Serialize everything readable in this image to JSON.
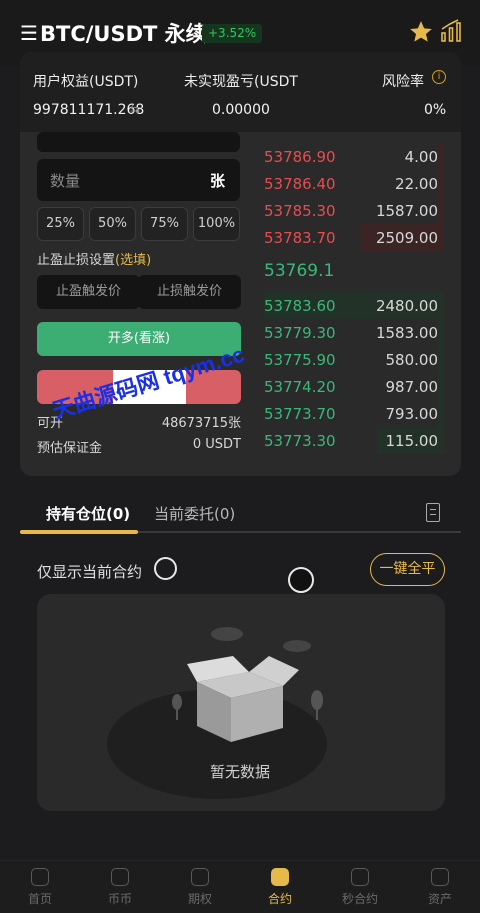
{
  "header": {
    "title": "BTC/USDT 永续",
    "change": "+3.52%"
  },
  "account": {
    "equity_label": "用户权益(USDT)",
    "equity_value": "997811171.268",
    "pnl_label": "未实现盈亏(USDT",
    "pnl_value": "0.00000",
    "risk_label": "风险率",
    "risk_value": "0%"
  },
  "form": {
    "qty_placeholder": "数量",
    "qty_unit": "张",
    "percents": [
      "25%",
      "50%",
      "75%",
      "100%"
    ],
    "tpsl_label": "止盈止损设置",
    "tpsl_optional": "(选填)",
    "tp_placeholder": "止盈触发价",
    "sl_placeholder": "止损触发价",
    "open_long": "开多(看涨)",
    "available_label": "可开",
    "available_value": "48673715张",
    "margin_label": "预估保证金",
    "margin_value": "0 USDT"
  },
  "orderbook": {
    "asks": [
      {
        "price": "53786.90",
        "size": "4.00",
        "depth": 0.04
      },
      {
        "price": "53786.40",
        "size": "22.00",
        "depth": 0.04
      },
      {
        "price": "53785.30",
        "size": "1587.00",
        "depth": 0.04
      },
      {
        "price": "53783.70",
        "size": "2509.00",
        "depth": 0.47
      }
    ],
    "last_price": "53769.1",
    "bids": [
      {
        "price": "53783.60",
        "size": "2480.00",
        "depth": 1.0
      },
      {
        "price": "53779.30",
        "size": "1583.00",
        "depth": 0.04
      },
      {
        "price": "53775.90",
        "size": "580.00",
        "depth": 0.04
      },
      {
        "price": "53774.20",
        "size": "987.00",
        "depth": 0.04
      },
      {
        "price": "53773.70",
        "size": "793.00",
        "depth": 0.04
      },
      {
        "price": "53773.30",
        "size": "115.00",
        "depth": 0.37
      }
    ]
  },
  "watermark": "天曲源码网 tqym.cc",
  "tabs": {
    "positions": "持有仓位(0)",
    "orders": "当前委托(0)"
  },
  "filters": {
    "only_current": "仅显示当前合约",
    "close_all": "一键全平"
  },
  "empty": "暂无数据",
  "nav": [
    {
      "label": "首页",
      "icon": "home-icon"
    },
    {
      "label": "币币",
      "icon": "coin-icon"
    },
    {
      "label": "期权",
      "icon": "options-icon"
    },
    {
      "label": "合约",
      "icon": "contract-icon",
      "active": true
    },
    {
      "label": "秒合约",
      "icon": "second-contract-icon"
    },
    {
      "label": "资产",
      "icon": "wallet-icon"
    }
  ],
  "colors": {
    "accent": "#e5b94a",
    "up": "#3ab878",
    "down": "#e84c50"
  }
}
